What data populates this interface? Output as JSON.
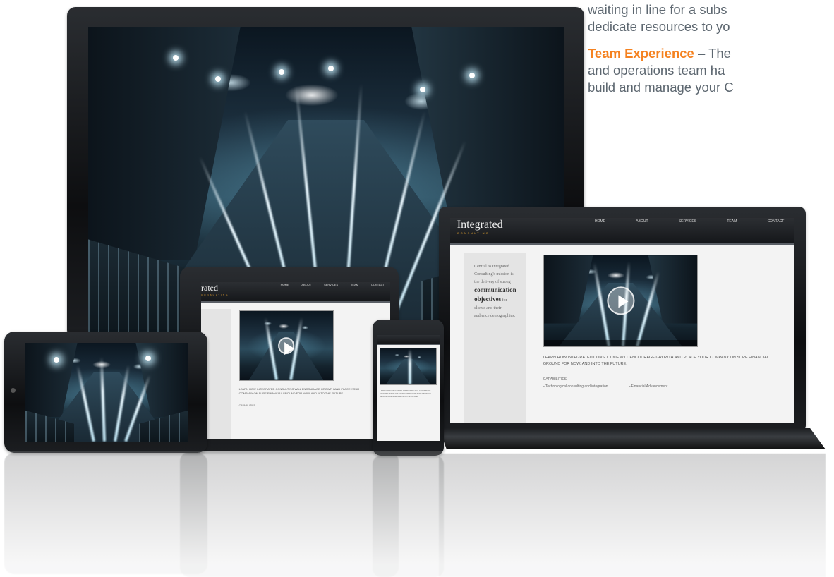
{
  "copy": {
    "line1": "waiting in line for a subs",
    "line2": "dedicate resources to yo",
    "team_label": "Team Experience",
    "team_line1": " – The",
    "team_line2": "and operations team ha",
    "team_line3": "build and manage your C"
  },
  "site": {
    "logo": "Integrated",
    "logo_partial": "rated",
    "logo_sub": "CONSULTING",
    "nav": [
      "HOME",
      "ABOUT",
      "SERVICES",
      "TEAM",
      "CONTACT"
    ],
    "side_text_1": "Central to Integrated Consulting's mission is the delivery of strong",
    "side_bold": "communication objectives",
    "side_text_2": "for clients and their audience demographics.",
    "learn": "LEARN HOW INTEGRATED CONSULTING WILL ENCOURAGE GROWTH AND PLACE YOUR COMPANY ON SURE FINANCIAL GROUND FOR NOW, AND INTO THE FUTURE.",
    "capabilities_title": "CAPABILITIES",
    "capabilities": [
      "Technological consulting and integration",
      "Financial Advancement"
    ]
  },
  "colors": {
    "accent": "#f58220",
    "body_text": "#5d6770"
  }
}
